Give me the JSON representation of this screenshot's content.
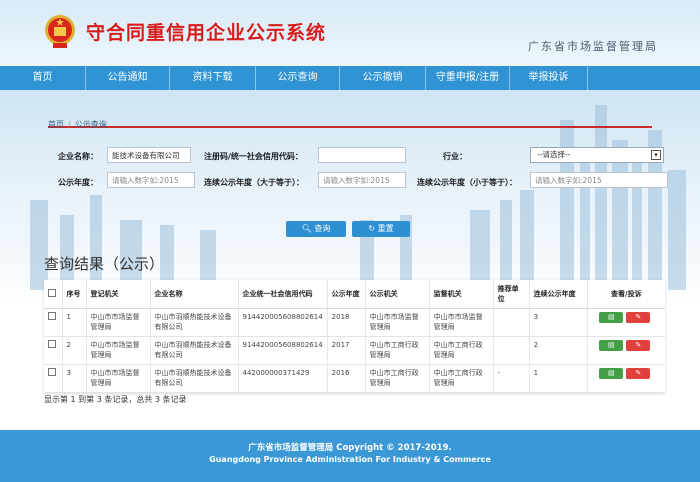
{
  "header": {
    "site_title": "守合同重信用企业公示系统",
    "org_name": "广东省市场监督管理局"
  },
  "nav": {
    "items": [
      {
        "label": "首页",
        "w": 86
      },
      {
        "label": "公告通知",
        "w": 84
      },
      {
        "label": "资料下载",
        "w": 86
      },
      {
        "label": "公示查询",
        "w": 84
      },
      {
        "label": "公示撤销",
        "w": 86
      },
      {
        "label": "守重申报/注册",
        "w": 84
      },
      {
        "label": "举报投诉",
        "w": 78
      }
    ]
  },
  "breadcrumb": {
    "home": "首页",
    "sep": "/",
    "current": "公示查询"
  },
  "form": {
    "company_label": "企业名称：",
    "company_value": "能技术设备有限公司",
    "code_label": "注册码/统一社会信用代码：",
    "code_value": "",
    "industry_label": "行业：",
    "industry_value": "--请选择--",
    "year_label": "公示年度：",
    "year_placeholder": "请输入数字如:2015",
    "cont_ge_label": "连续公示年度（大于等于）：",
    "cont_ge_placeholder": "请输入数字如:2015",
    "cont_le_label": "连续公示年度（小于等于）：",
    "cont_le_placeholder": "请输入数字如:2015",
    "search_label": "查询",
    "reset_label": "重置"
  },
  "results": {
    "title": "查询结果（公示）",
    "columns": [
      "",
      "序号",
      "登记机关",
      "企业名称",
      "企业统一社会信用代码",
      "公示年度",
      "公示机关",
      "监督机关",
      "推荐单位",
      "连续公示年度",
      "查看/投诉"
    ],
    "rows": [
      {
        "no": "1",
        "reg": "中山市市场监督管理局",
        "name": "中山市羽顺热能技术设备有限公司",
        "code": "914420005608802614",
        "year": "2018",
        "pub": "中山市市场监督管理局",
        "sup": "中山市市场监督管理局",
        "rec": "",
        "cont": "3"
      },
      {
        "no": "2",
        "reg": "中山市市场监督管理局",
        "name": "中山市羽顺热能技术设备有限公司",
        "code": "914420005608802614",
        "year": "2017",
        "pub": "中山市工商行政管理局",
        "sup": "中山市工商行政管理局",
        "rec": "",
        "cont": "2"
      },
      {
        "no": "3",
        "reg": "中山市市场监督管理局",
        "name": "中山市羽顺热能技术设备有限公司",
        "code": "442000000371429",
        "year": "2016",
        "pub": "中山市工商行政管理局",
        "sup": "中山市工商行政管理局",
        "rec": "-",
        "cont": "1"
      }
    ],
    "summary": "显示第 1 到第 3 条记录，总共 3 条记录"
  },
  "footer": {
    "line1": "广东省市场监督管理局 Copyright © 2017-2019.",
    "line2": "Guangdong Province Administration For Industry & Commerce"
  },
  "icons": {
    "view": "file-icon",
    "edit": "edit-icon",
    "search": "search-icon",
    "reset": "refresh-icon"
  },
  "colors": {
    "nav": "#2f93d4",
    "title_red": "#d81c1c",
    "view_btn": "#43a047",
    "edit_btn": "#e0413d",
    "footer": "#3b98d6"
  }
}
